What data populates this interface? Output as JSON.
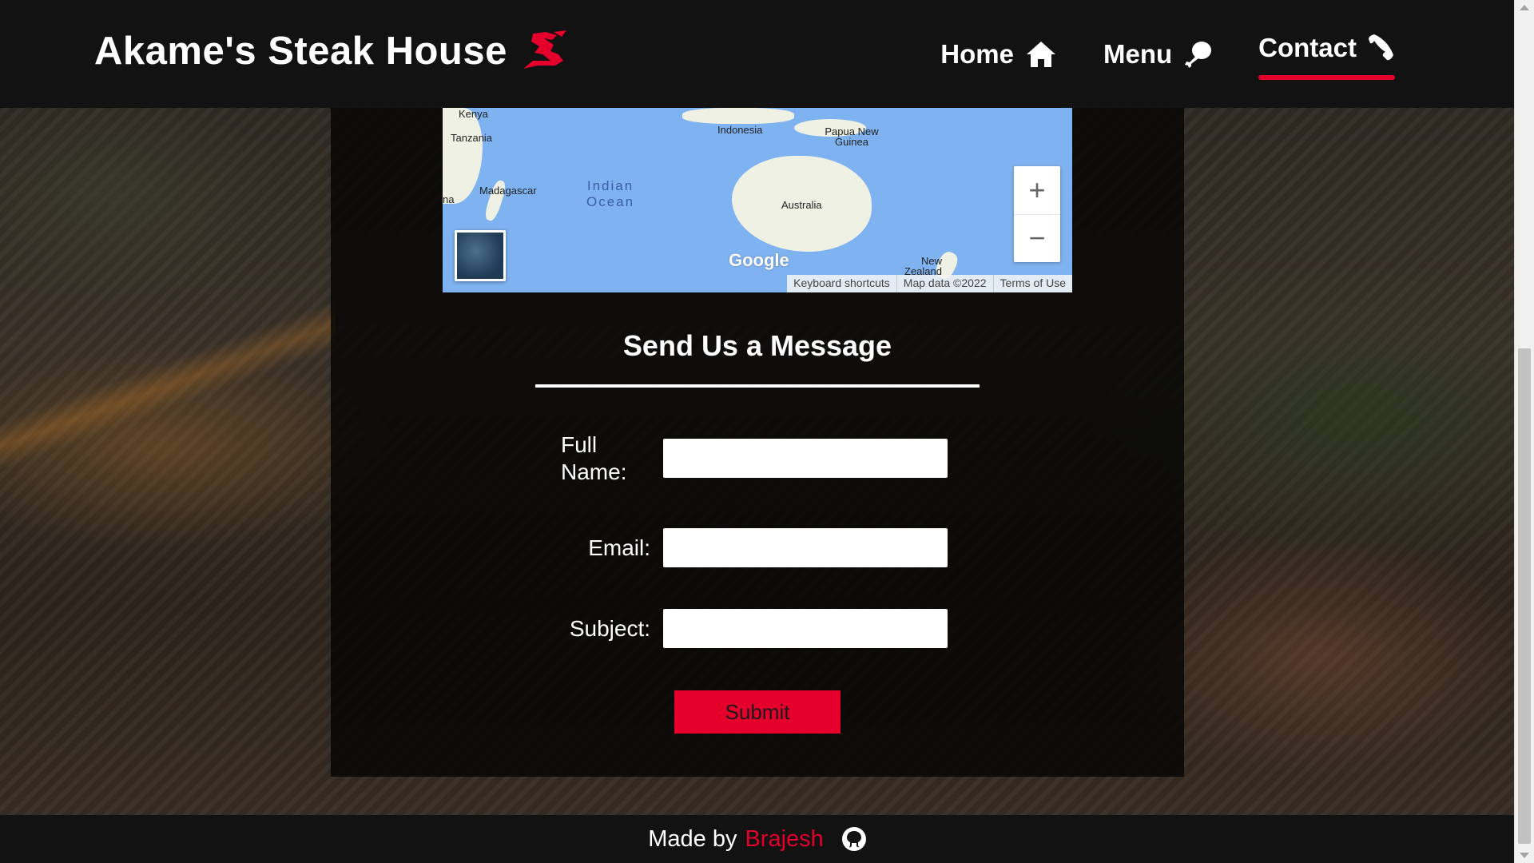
{
  "header": {
    "brand": "Akame's Steak House",
    "nav": [
      {
        "label": "Home",
        "icon": "home-icon"
      },
      {
        "label": "Menu",
        "icon": "drumstick-icon"
      },
      {
        "label": "Contact",
        "icon": "phone-icon",
        "active": true
      }
    ]
  },
  "map": {
    "labels": [
      "Kenya",
      "Tanzania",
      "Madagascar",
      "Indonesia",
      "Papua New Guinea",
      "Australia",
      "New Zealand",
      "na"
    ],
    "ocean_label": [
      "Indian",
      "Ocean"
    ],
    "logo": "Google",
    "zoom_in": "+",
    "zoom_out": "−",
    "footer": [
      "Keyboard shortcuts",
      "Map data ©2022",
      "Terms of Use"
    ]
  },
  "form": {
    "title": "Send Us a Message",
    "fields": [
      {
        "label_line1": "Full",
        "label_line2": "Name:",
        "value": ""
      },
      {
        "label": "Email:",
        "value": ""
      },
      {
        "label": "Subject:",
        "value": ""
      }
    ],
    "submit": "Submit"
  },
  "footer": {
    "made_by": "Made by",
    "author": "Brajesh",
    "icon": "github-icon"
  },
  "colors": {
    "accent": "#e4002b",
    "header_bg": "#121212",
    "map_water": "#7fb2f0"
  }
}
